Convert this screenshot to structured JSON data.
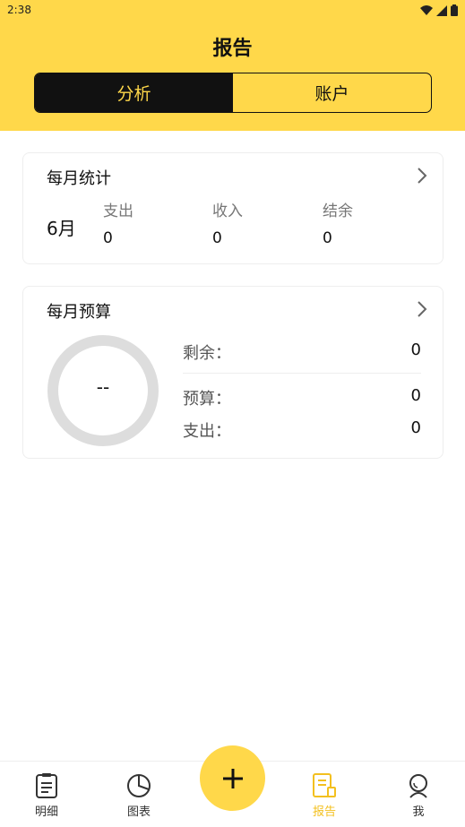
{
  "status_bar": {
    "time": "2:38"
  },
  "header": {
    "title": "报告",
    "tabs": [
      {
        "label": "分析",
        "active": true
      },
      {
        "label": "账户",
        "active": false
      }
    ]
  },
  "monthly_stats": {
    "title": "每月统计",
    "month": "6月",
    "columns": [
      {
        "label": "支出",
        "value": "0"
      },
      {
        "label": "收入",
        "value": "0"
      },
      {
        "label": "结余",
        "value": "0"
      }
    ]
  },
  "monthly_budget": {
    "title": "每月预算",
    "ring_text": "--",
    "rows": [
      {
        "label": "剩余：",
        "value": "0"
      },
      {
        "label": "预算：",
        "value": "0"
      },
      {
        "label": "支出：",
        "value": "0"
      }
    ]
  },
  "bottom_nav": {
    "items": [
      {
        "label": "明细",
        "icon": "list-document-icon"
      },
      {
        "label": "图表",
        "icon": "pie-chart-icon"
      },
      {
        "label": "报告",
        "icon": "report-icon",
        "active": true
      },
      {
        "label": "我",
        "icon": "profile-icon"
      }
    ],
    "fab_icon": "plus-icon"
  },
  "colors": {
    "accent": "#FFD84A",
    "active_nav": "#F3C01F",
    "dark": "#111111",
    "ring": "#DDDDDD"
  }
}
